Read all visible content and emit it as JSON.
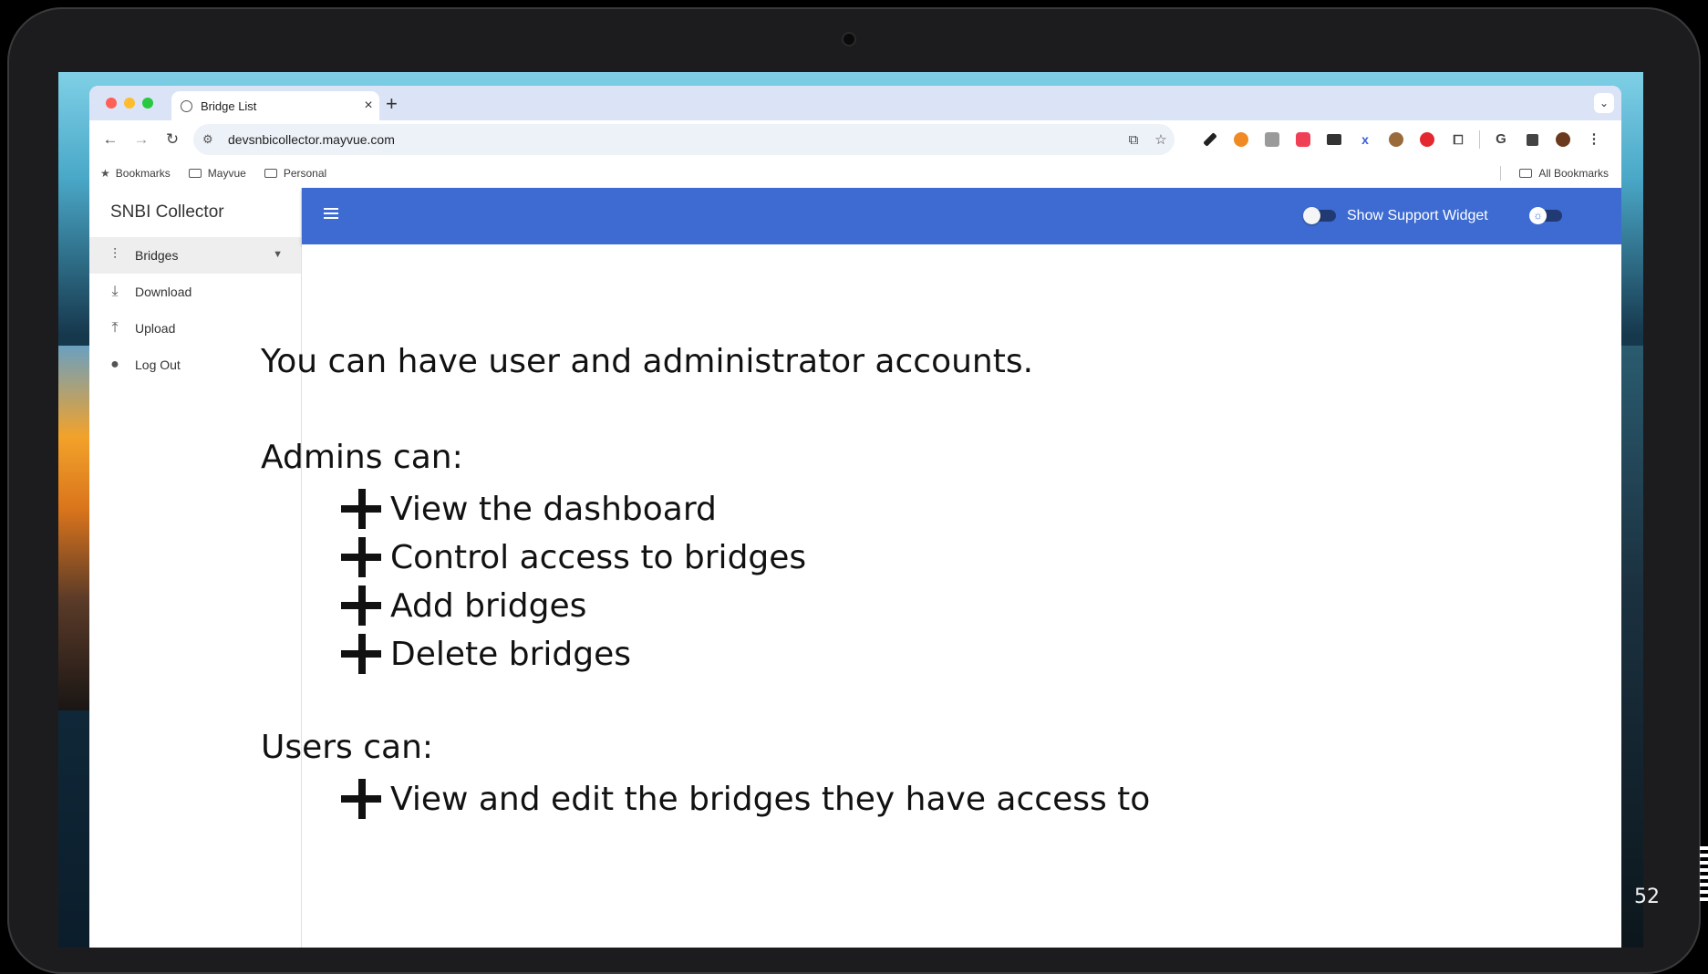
{
  "browser": {
    "tab_title": "Bridge List",
    "tab_close": "×",
    "new_tab": "+",
    "url": "devsnbicollector.mayvue.com",
    "bookmarks": [
      "Bookmarks",
      "Mayvue",
      "Personal"
    ],
    "all_bookmarks": "All Bookmarks"
  },
  "sidebar": {
    "brand": "SNBI Collector",
    "items": [
      {
        "label": "Bridges",
        "icon": "bridges-icon",
        "active": true
      },
      {
        "label": "Download",
        "icon": "download-icon"
      },
      {
        "label": "Upload",
        "icon": "upload-icon"
      },
      {
        "label": "Log Out",
        "icon": "person-icon"
      }
    ]
  },
  "appbar": {
    "support_label": "Show Support Widget",
    "support_enabled": false,
    "theme_toggle_enabled": false,
    "color": "#3d6bd1"
  },
  "slide": {
    "intro": "You can have user and administrator accounts.",
    "admins_heading": "Admins can:",
    "admin_items": [
      "View the dashboard",
      "Control access to bridges",
      "Add bridges",
      "Delete bridges"
    ],
    "users_heading": "Users can:",
    "user_items": [
      "View and edit the bridges they have access to"
    ],
    "page_number": "52"
  }
}
